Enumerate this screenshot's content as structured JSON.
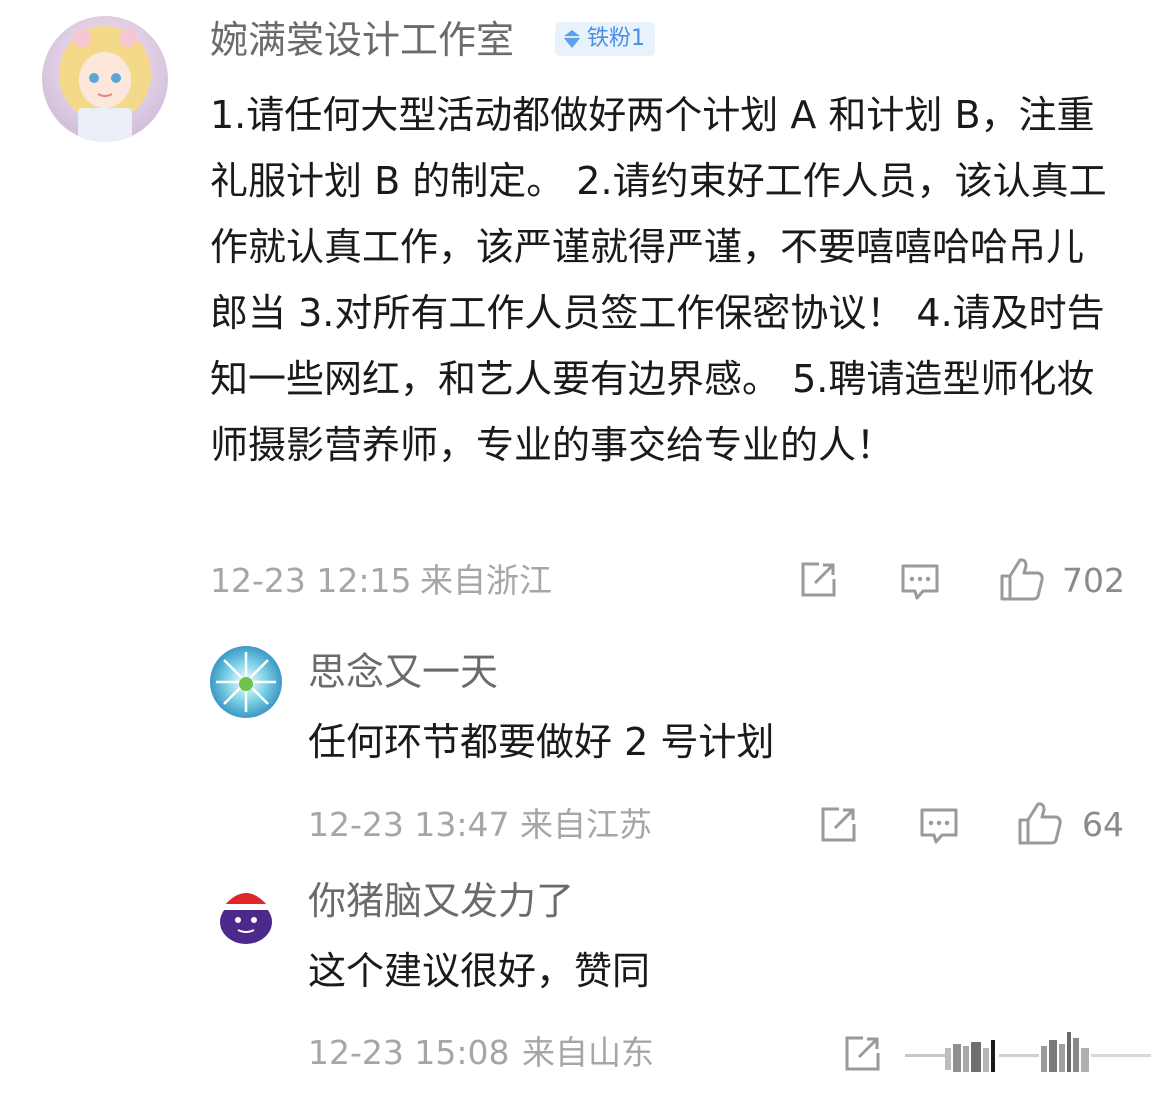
{
  "main_comment": {
    "author": "婉满裳设计工作室",
    "badge_label": "铁粉1",
    "content": "1.请任何大型活动都做好两个计划 A 和计划 B，注重礼服计划 B 的制定。 2.请约束好工作人员，该认真工作就认真工作，该严谨就得严谨，不要嘻嘻哈哈吊儿郎当 3.对所有工作人员签工作保密协议！ 4.请及时告知一些网红，和艺人要有边界感。 5.聘请造型师化妆师摄影营养师，专业的事交给专业的人！",
    "timestamp": "12-23 12:15",
    "location": "来自浙江",
    "like_count": "702",
    "icons": {
      "share": "share-icon",
      "comment": "comment-icon",
      "like": "like-icon"
    }
  },
  "replies": [
    {
      "author": "思念又一天",
      "content": "任何环节都要做好 2 号计划",
      "timestamp": "12-23 13:47",
      "location": "来自江苏",
      "like_count": "64"
    },
    {
      "author": "你猪脑又发力了",
      "content": "这个建议很好，赞同",
      "timestamp": "12-23 15:08",
      "location": "来自山东",
      "like_count": ""
    }
  ],
  "colors": {
    "name": "#6b6b6b",
    "body_text": "#1a1a1a",
    "meta": "#a6a6a6",
    "icon": "#9a9a9a",
    "badge_bg": "#e8f2fd",
    "badge_text": "#4a90e2"
  }
}
